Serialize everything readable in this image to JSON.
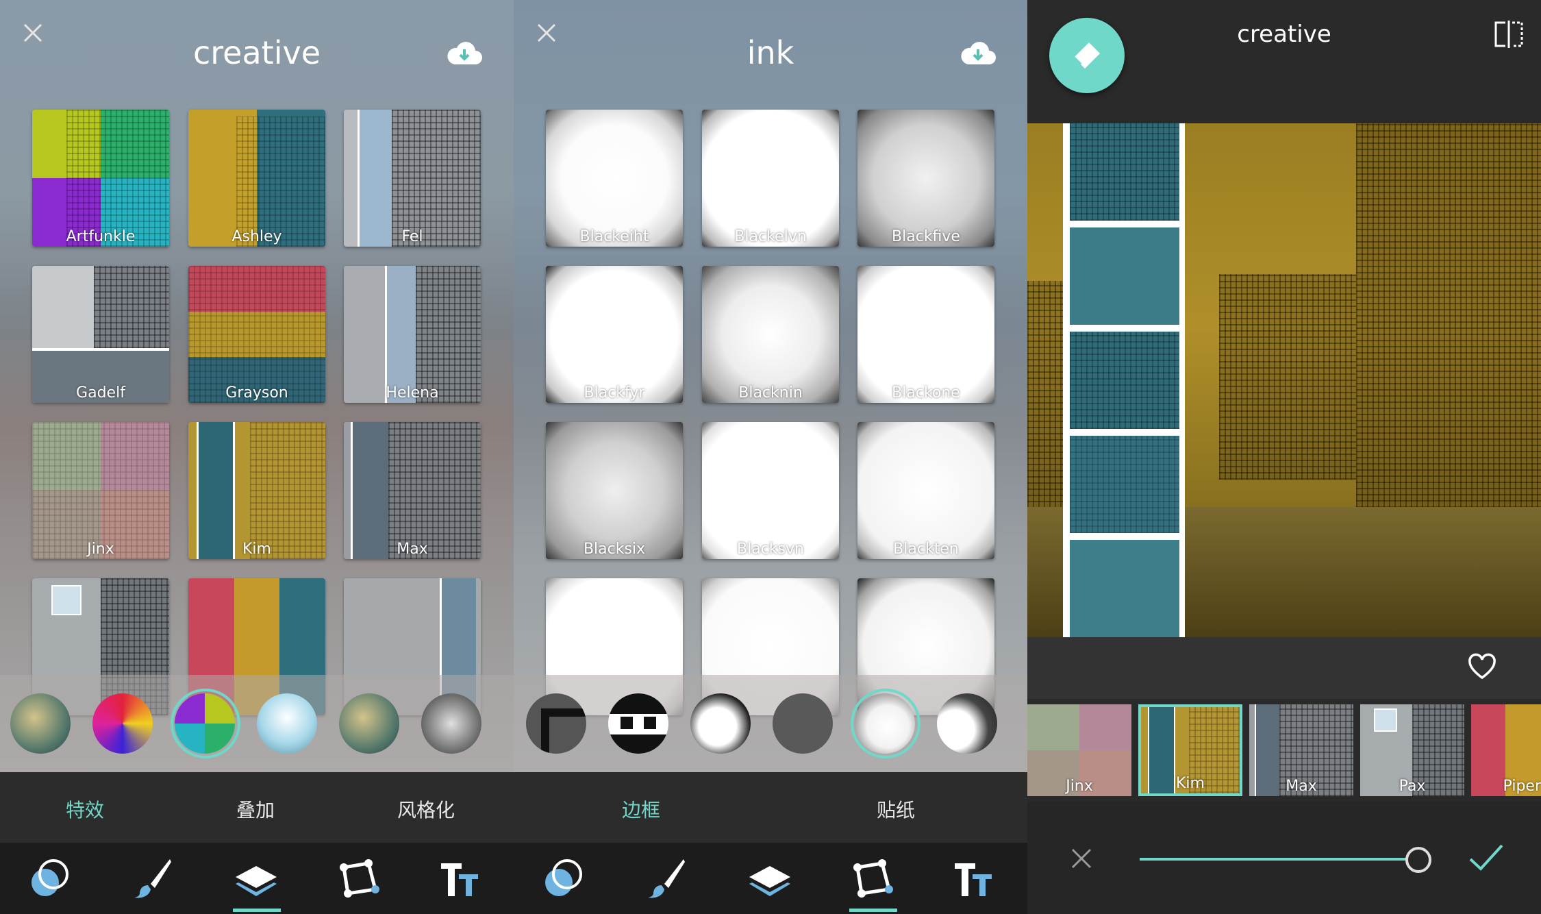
{
  "panel1": {
    "title": "creative",
    "tiles": [
      "Artfunkle",
      "Ashley",
      "Fel",
      "Gadelf",
      "Grayson",
      "Helena",
      "Jinx",
      "Kim",
      "Max",
      "",
      "",
      ""
    ],
    "tabs": [
      "特效",
      "叠加",
      "风格化"
    ]
  },
  "panel2": {
    "title": "ink",
    "tiles": [
      "Blackeiht",
      "Blackelvn",
      "Blackfive",
      "Blackfyr",
      "Blacknin",
      "Blackone",
      "Blacksix",
      "Blacksvn",
      "Blackten",
      "",
      "",
      ""
    ],
    "tabs": [
      "边框",
      "贴纸"
    ]
  },
  "panel3": {
    "title": "creative",
    "thumbs": [
      "Jinx",
      "Kim",
      "Max",
      "Pax",
      "Piper"
    ],
    "slider_value": 1.0
  },
  "colors": {
    "accent": "#6fd8c8",
    "mustard": "#c9a43a",
    "teal": "#3f7f8c"
  },
  "icons": [
    "close-icon",
    "cloud-download-icon",
    "eraser-icon",
    "compare-icon",
    "heart-icon",
    "check-icon",
    "effects-icon",
    "brush-icon",
    "layers-icon",
    "crop-icon",
    "text-icon"
  ]
}
